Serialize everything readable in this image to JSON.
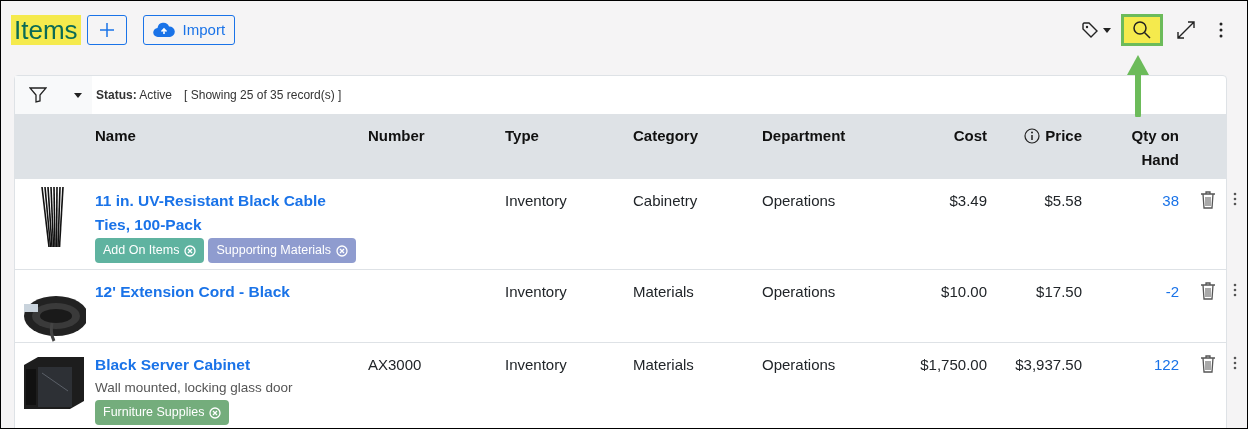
{
  "header": {
    "title": "Items",
    "title_highlighted": true,
    "import_label": "Import",
    "search_highlighted": true,
    "arrow_annotation": true
  },
  "filter_bar": {
    "status_label": "Status:",
    "status_value": "Active",
    "showing": "[ Showing 25 of 35 record(s) ]"
  },
  "table": {
    "columns": [
      {
        "label": "Name"
      },
      {
        "label": "Number"
      },
      {
        "label": "Type"
      },
      {
        "label": "Category"
      },
      {
        "label": "Department"
      },
      {
        "label": "Cost"
      },
      {
        "label": "Price",
        "info": true
      },
      {
        "label": "Qty on Hand"
      }
    ],
    "rows": [
      {
        "name": "11 in. UV-Resistant Black Cable Ties, 100-Pack",
        "number": "",
        "type": "Inventory",
        "category": "Cabinetry",
        "department": "Operations",
        "cost": "$3.49",
        "price": "$5.58",
        "qty": "38",
        "tags": [
          {
            "label": "Add On Items",
            "color": "#5fb3a0"
          },
          {
            "label": "Supporting Materials",
            "color": "#8f9ccf"
          }
        ]
      },
      {
        "name": "12' Extension Cord - Black",
        "number": "",
        "type": "Inventory",
        "category": "Materials",
        "department": "Operations",
        "cost": "$10.00",
        "price": "$17.50",
        "qty": "-2",
        "tags": []
      },
      {
        "name": "Black Server Cabinet",
        "description": "Wall mounted, locking glass door",
        "number": "AX3000",
        "type": "Inventory",
        "category": "Materials",
        "department": "Operations",
        "cost": "$1,750.00",
        "price": "$3,937.50",
        "qty": "122",
        "tags": [
          {
            "label": "Furniture Supplies",
            "color": "#74ad7c"
          }
        ]
      }
    ]
  }
}
